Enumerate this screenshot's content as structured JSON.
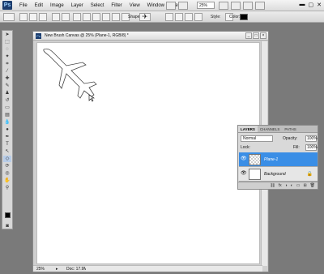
{
  "app": {
    "logo": "Ps"
  },
  "menu": {
    "items": [
      "File",
      "Edit",
      "Image",
      "Layer",
      "Select",
      "Filter",
      "View",
      "Window",
      "Help"
    ],
    "zoom": "25%"
  },
  "options_bar": {
    "shape_label": "Shape:",
    "style_label": "Style:",
    "color_label": "Color:",
    "color": "#000000"
  },
  "document": {
    "title": "New Brush Canvas @ 25% (Plane-1, RGB/8) *",
    "zoom": "25%",
    "doc_size": "Doc: 17.9M/0 bytes"
  },
  "layers_panel": {
    "tabs": [
      "LAYERS",
      "CHANNELS",
      "PATHS"
    ],
    "blend_mode": "Normal",
    "opacity_label": "Opacity:",
    "opacity": "100%",
    "lock_label": "Lock:",
    "fill_label": "Fill:",
    "fill": "100%",
    "layers": [
      {
        "name": "Plane-1",
        "selected": true
      },
      {
        "name": "Background",
        "selected": false
      }
    ]
  },
  "colors": {
    "selection": "#3a8ee6",
    "foreground": "#000000",
    "background": "#ffffff"
  }
}
